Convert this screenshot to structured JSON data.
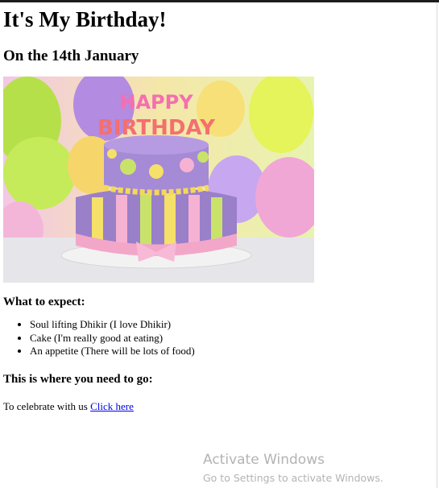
{
  "page": {
    "heading": "It's My Birthday!",
    "subheading": "On the 14th January",
    "image_text": {
      "line1": "HAPPY",
      "line2": "BIRTHDAY"
    },
    "expect_title": "What to expect:",
    "expect_items": [
      "Soul lifting Dhikir (I love Dhikir)",
      "Cake (I'm really good at eating)",
      "An appetite (There will be lots of food)"
    ],
    "goto_title": "This is where you need to go:",
    "celebrate_text": "To celebrate with us ",
    "link_label": "Click here"
  },
  "watermark": {
    "title": "Activate Windows",
    "subtitle": "Go to Settings to activate Windows."
  },
  "colors": {
    "link": "#0000ee",
    "cake_purple": "#9a7fc9",
    "cake_pink": "#f2a7c9"
  }
}
